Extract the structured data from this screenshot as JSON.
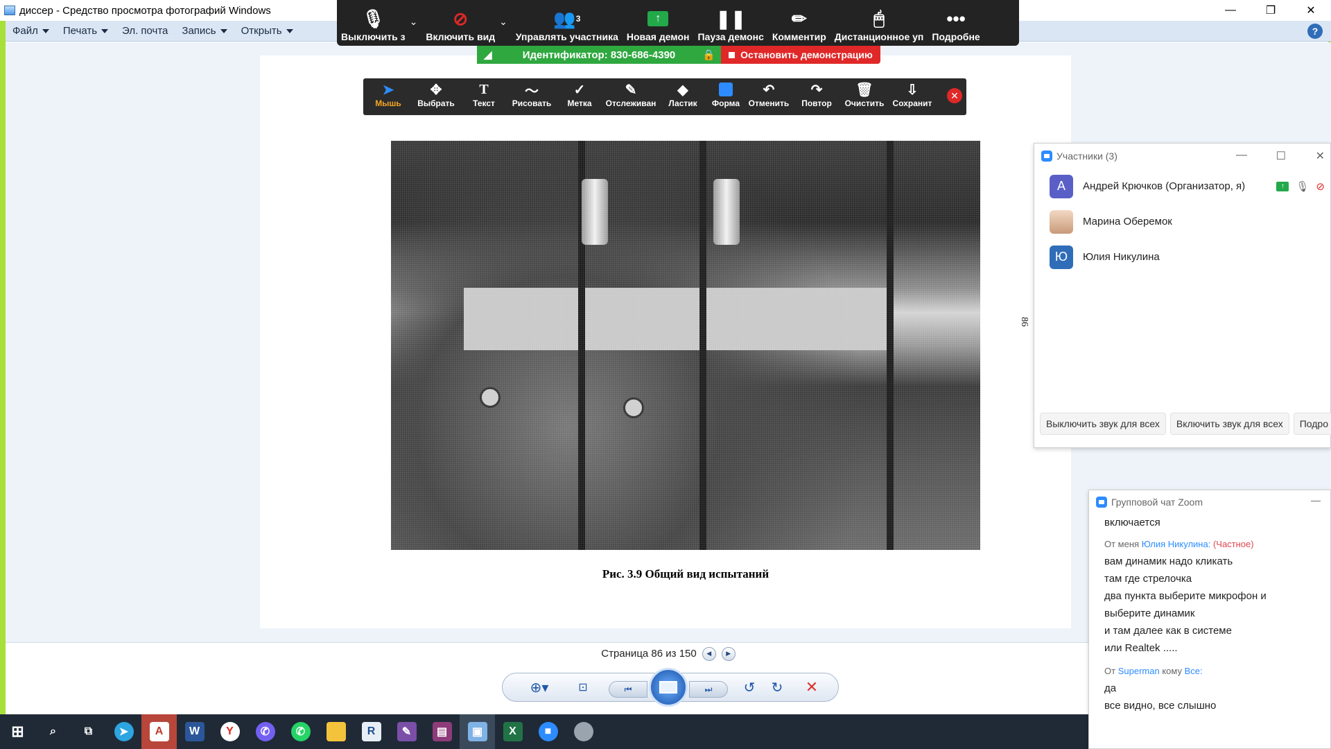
{
  "window": {
    "title": "диссер - Средство просмотра фотографий Windows",
    "min_glyph": "—",
    "max_glyph": "❐",
    "close_glyph": "✕"
  },
  "menu": {
    "items": [
      {
        "label": "Файл",
        "has_caret": true
      },
      {
        "label": "Печать",
        "has_caret": true
      },
      {
        "label": "Эл. почта",
        "has_caret": false
      },
      {
        "label": "Запись",
        "has_caret": true
      },
      {
        "label": "Открыть",
        "has_caret": true
      }
    ],
    "help": "?"
  },
  "zoom_toolbar": {
    "mute_label": "Выключить з",
    "video_label": "Включить вид",
    "participants_label": "Управлять участника",
    "participants_count": "3",
    "new_share_label": "Новая демон",
    "pause_label": "Пауза демонс",
    "annotate_label": "Комментир",
    "remote_label": "Дистанционное уп",
    "more_label": "Подробне"
  },
  "meeting": {
    "id_text": "Идентификатор: 830-686-4390",
    "stop_share": "Остановить демонстрацию"
  },
  "annotation_tools": [
    {
      "label": "Мышь",
      "icon": "mouse-pointer-icon",
      "glyph": "➤",
      "selected": true
    },
    {
      "label": "Выбрать",
      "icon": "move-icon",
      "glyph": "✥",
      "selected": false
    },
    {
      "label": "Текст",
      "icon": "text-icon",
      "glyph": "T",
      "selected": false
    },
    {
      "label": "Рисовать",
      "icon": "draw-icon",
      "glyph": "〜",
      "selected": false
    },
    {
      "label": "Метка",
      "icon": "stamp-icon",
      "glyph": "✓",
      "selected": false
    },
    {
      "label": "Отслеживан",
      "icon": "spotlight-icon",
      "glyph": "✎",
      "selected": false
    },
    {
      "label": "Ластик",
      "icon": "eraser-icon",
      "glyph": "◆",
      "selected": false
    },
    {
      "label": "Форма",
      "icon": "shape-icon",
      "glyph": "",
      "selected": false
    },
    {
      "label": "Отменить",
      "icon": "undo-icon",
      "glyph": "↶",
      "selected": false
    },
    {
      "label": "Повтор",
      "icon": "redo-icon",
      "glyph": "↷",
      "selected": false
    },
    {
      "label": "Очистить",
      "icon": "trash-icon",
      "glyph": "🗑",
      "selected": false
    },
    {
      "label": "Сохранит",
      "icon": "save-icon",
      "glyph": "⇩",
      "selected": false
    }
  ],
  "document": {
    "caption": "Рис. 3.9 Общий вид испытаний",
    "side_page_number": "86"
  },
  "status": {
    "page_text": "Страница 86 из 150"
  },
  "participants": {
    "title": "Участники (3)",
    "list": [
      {
        "initial": "А",
        "name": "Андрей Крючков (Организатор, я)",
        "avatar_color": "#5a5fc8"
      },
      {
        "initial": "",
        "name": "Марина Оберемок",
        "avatar_color": "#e8c4a8"
      },
      {
        "initial": "Ю",
        "name": "Юлия Никулина",
        "avatar_color": "#2f6db8"
      }
    ],
    "mute_all": "Выключить звук для всех",
    "unmute_all": "Включить звук для всех",
    "more": "Подро"
  },
  "chat": {
    "title": "Групповой чат Zoom",
    "first_line": "включается",
    "msg1_from_prefix": "От меня",
    "msg1_to": "Юлия Никулина:",
    "msg1_private": "(Частное)",
    "msg1_lines": [
      "вам динамик надо кликать",
      "там где стрелочка",
      "два пункта выберите микрофон и",
      "выберите динамик",
      "и там далее как в системе",
      "или Realtek ....."
    ],
    "msg2_from_prefix": "От",
    "msg2_from": "Superman",
    "msg2_mid": "кому",
    "msg2_to": "Все:",
    "msg2_lines": [
      "да",
      "все видно, все слышно"
    ]
  },
  "colors": {
    "zoom_blue": "#2d8cff",
    "share_green": "#2ea83f",
    "stop_red": "#e02828",
    "frame_green": "#a8e03a"
  }
}
